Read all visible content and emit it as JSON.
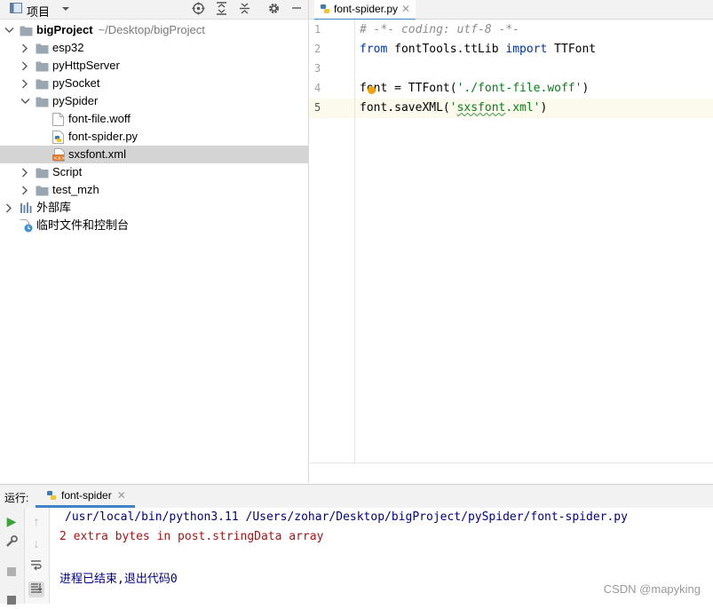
{
  "project_panel": {
    "title": "项目",
    "tree": [
      {
        "label": "bigProject",
        "path": "~/Desktop/bigProject",
        "type": "folder",
        "expanded": true,
        "level": 0
      },
      {
        "label": "esp32",
        "type": "folder",
        "expanded": false,
        "level": 1
      },
      {
        "label": "pyHttpServer",
        "type": "folder",
        "expanded": false,
        "level": 1
      },
      {
        "label": "pySocket",
        "type": "folder",
        "expanded": false,
        "level": 1
      },
      {
        "label": "pySpider",
        "type": "folder",
        "expanded": true,
        "level": 1
      },
      {
        "label": "font-file.woff",
        "type": "file",
        "level": 2
      },
      {
        "label": "font-spider.py",
        "type": "python",
        "level": 2
      },
      {
        "label": "sxsfont.xml",
        "type": "xml",
        "level": 2,
        "selected": true
      },
      {
        "label": "Script",
        "type": "folder",
        "expanded": false,
        "level": 1
      },
      {
        "label": "test_mzh",
        "type": "folder",
        "expanded": false,
        "level": 1
      },
      {
        "label": "外部库",
        "type": "library",
        "expanded": false,
        "level": 0
      },
      {
        "label": "临时文件和控制台",
        "type": "scratch",
        "level": 0
      }
    ]
  },
  "editor": {
    "tab_label": "font-spider.py",
    "line_numbers": [
      "1",
      "2",
      "3",
      "4",
      "5"
    ],
    "lines": {
      "l1": "# -*- coding: utf-8 -*-",
      "l2_kw1": "from",
      "l2_mid": " fontTools.ttLib ",
      "l2_kw2": "import",
      "l2_end": " TTFont",
      "l4_pre": "font = TTFont(",
      "l4_str": "'./font-file.woff'",
      "l4_end": ")",
      "l5_pre": "font.saveXML(",
      "l5_q1": "'",
      "l5_word": "sxsfont",
      "l5_q2": ".xml'",
      "l5_end": ")"
    }
  },
  "run_panel": {
    "label": "运行:",
    "tab_label": "font-spider",
    "output": [
      "/usr/local/bin/python3.11 /Users/zohar/Desktop/bigProject/pySpider/font-spider.py",
      "2 extra bytes in post.stringData array",
      "",
      "进程已结束,退出代码0"
    ]
  },
  "watermark": "CSDN @mapyking",
  "colors": {
    "selection": "#d4d4d4",
    "accent": "#4083c9",
    "keyword": "#0033b3",
    "string": "#067d17",
    "comment": "#8c8c8c",
    "console_path": "#000080",
    "console_error": "#a31515"
  },
  "icons": [
    "project-view-icon",
    "dropdown-arrow-icon",
    "locate-icon",
    "expand-all-icon",
    "collapse-all-icon",
    "gear-icon",
    "minimize-icon",
    "folder-icon",
    "python-file-icon",
    "xml-file-icon",
    "library-icon",
    "scratches-icon",
    "run-icon",
    "wrench-icon",
    "stop-icon",
    "up-arrow-icon",
    "down-arrow-icon",
    "soft-wrap-icon",
    "scroll-to-end-icon",
    "bulb-icon"
  ]
}
